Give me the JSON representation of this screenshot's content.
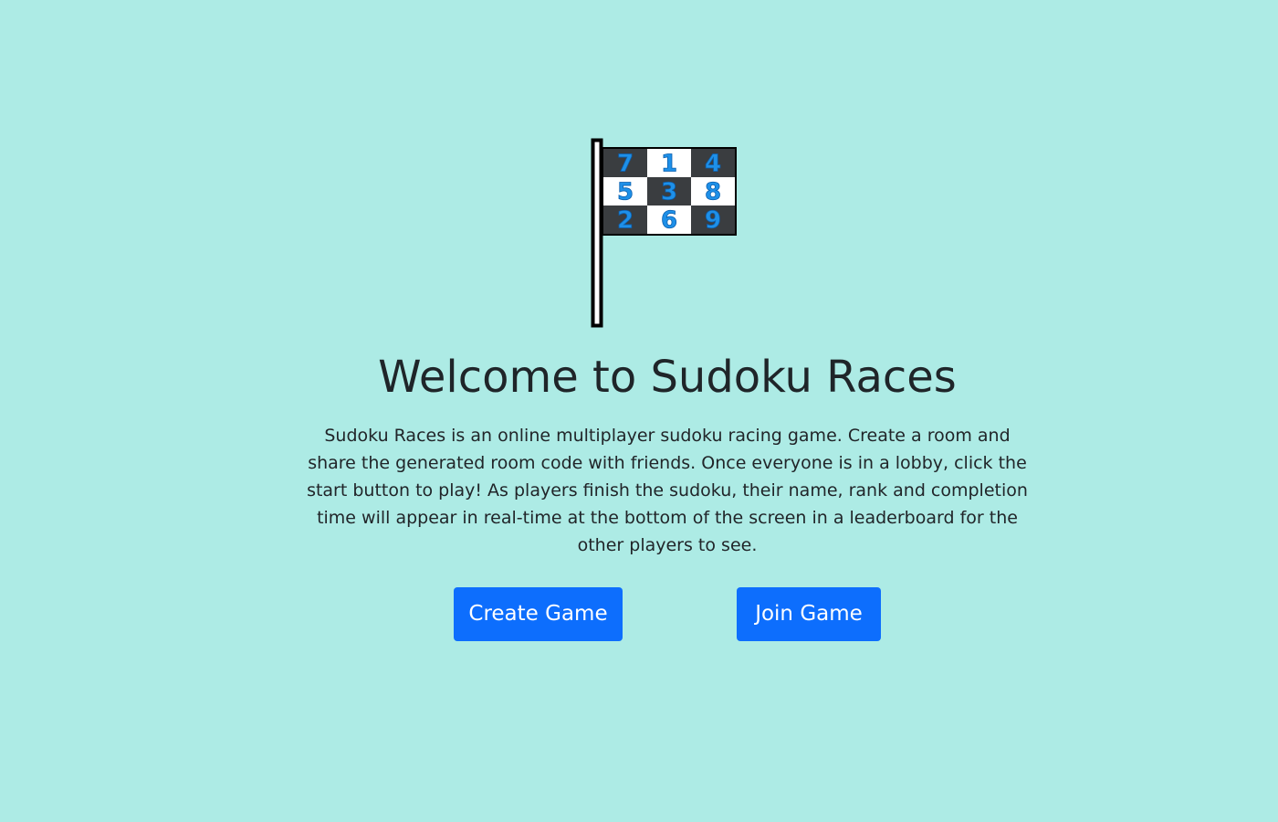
{
  "logo": {
    "icon": "checkered-sudoku-flag-icon",
    "grid": [
      [
        "7",
        "1",
        "4"
      ],
      [
        "5",
        "3",
        "8"
      ],
      [
        "2",
        "6",
        "9"
      ]
    ],
    "colors": {
      "dark_cell": "#3a3d40",
      "light_cell": "#ffffff",
      "digit": "#1e90e8",
      "pole": "#ffffff",
      "outline": "#000000"
    }
  },
  "header": {
    "title": "Welcome to Sudoku Races"
  },
  "main": {
    "description": "Sudoku Races is an online multiplayer sudoku racing game. Create a room and share the generated room code with friends. Once everyone is in a lobby, click the start button to play! As players finish the sudoku, their name, rank and completion time will appear in real-time at the bottom of the screen in a leaderboard for the other players to see."
  },
  "actions": {
    "create_label": "Create Game",
    "join_label": "Join Game"
  },
  "theme": {
    "background": "#adebe5",
    "button": "#0d6efd"
  }
}
